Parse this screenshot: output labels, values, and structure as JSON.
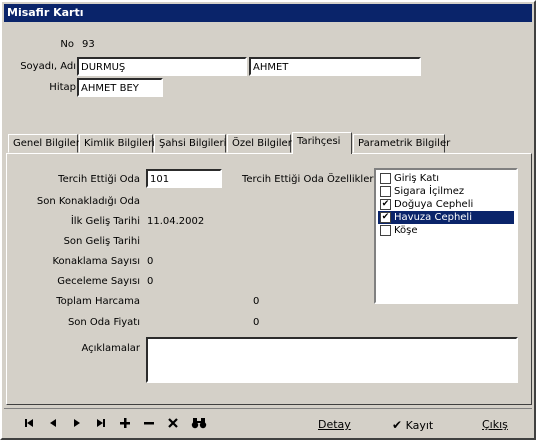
{
  "window": {
    "title": "Misafir Kartı"
  },
  "header": {
    "no_label": "No",
    "no_value": "93",
    "surname_label": "Soyadı, Adı",
    "surname_value": "DURMUŞ",
    "name_value": "AHMET",
    "title_label": "Hitap",
    "title_value": "AHMET BEY"
  },
  "tabs": [
    {
      "label": "Genel Bilgiler"
    },
    {
      "label": "Kimlik Bilgileri"
    },
    {
      "label": "Şahsi Bilgileri"
    },
    {
      "label": "Özel Bilgiler"
    },
    {
      "label": "Tarihçesi"
    },
    {
      "label": "Parametrik Bilgiler"
    }
  ],
  "history": {
    "preferred_room_label": "Tercih Ettiği Oda",
    "preferred_room_value": "101",
    "room_features_label": "Tercih Ettiği Oda Özellikleri",
    "last_room_label": "Son Konakladığı Oda",
    "first_arrival_label": "İlk Geliş Tarihi",
    "first_arrival_value": "11.04.2002",
    "last_arrival_label": "Son Geliş Tarihi",
    "stay_count_label": "Konaklama Sayısı",
    "stay_count_value": "0",
    "nights_label": "Geceleme Sayısı",
    "nights_value": "0",
    "total_spend_label": "Toplam Harcama",
    "total_spend_value": "0",
    "last_room_price_label": "Son Oda Fiyatı",
    "last_room_price_value": "0",
    "notes_label": "Açıklamalar",
    "notes_value": ""
  },
  "room_features": [
    {
      "label": "Giriş Katı",
      "checked": false,
      "selected": false
    },
    {
      "label": "Sigara İçilmez",
      "checked": false,
      "selected": false
    },
    {
      "label": "Doğuya Cepheli",
      "checked": true,
      "selected": false
    },
    {
      "label": "Havuza Cepheli",
      "checked": true,
      "selected": true
    },
    {
      "label": "Köşe",
      "checked": false,
      "selected": false
    }
  ],
  "toolbar": {
    "first_icon": "first-record-icon",
    "prev_icon": "previous-record-icon",
    "next_icon": "next-record-icon",
    "last_icon": "last-record-icon",
    "add_icon": "add-icon",
    "delete_icon": "delete-icon",
    "cancel_icon": "cancel-icon",
    "search_icon": "binoculars-icon",
    "detail_label": "Detay",
    "save_label": "Kayıt",
    "exit_label": "Çıkış"
  },
  "colors": {
    "titlebar": "#0a246a",
    "face": "#d4d0c8",
    "selection": "#0a246a"
  }
}
